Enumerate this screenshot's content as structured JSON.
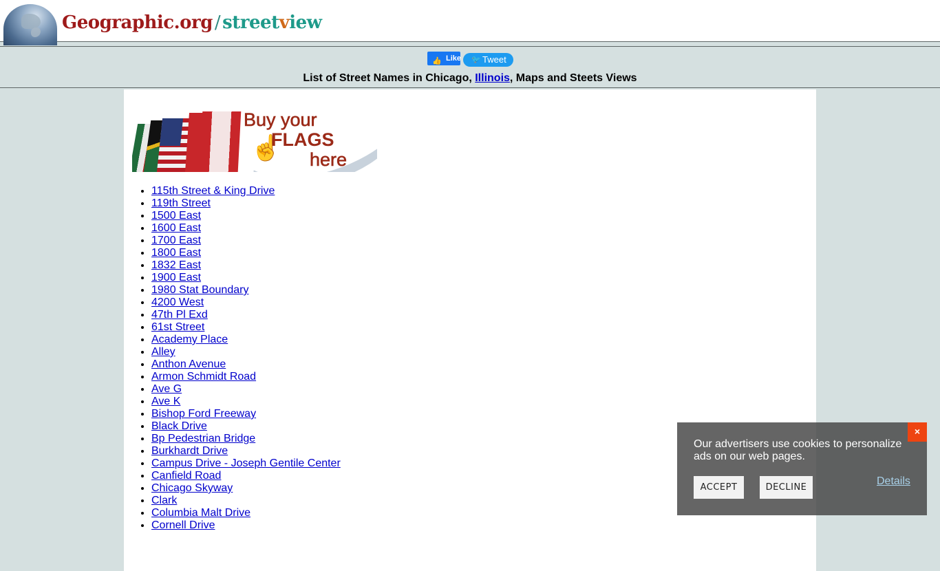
{
  "header": {
    "logo_part1": "Geographic.org",
    "logo_slash": "/",
    "logo_part2a": "street",
    "logo_part2b": "v",
    "logo_part2c": "iew",
    "globe_icon": "globe-icon"
  },
  "social": {
    "like_label": "Like",
    "like_icon": "thumbs-up-icon",
    "tweet_label": "Tweet",
    "tweet_icon": "twitter-bird-icon"
  },
  "heading": {
    "prefix": "List of Street Names in Chicago, ",
    "link": "Illinois",
    "suffix": ", Maps and Steets Views"
  },
  "banner": {
    "line1": "Buy your",
    "line2": "FLAGS",
    "line3": "here",
    "cursor_icon": "hand-pointer-icon"
  },
  "streets": [
    "115th Street & King Drive",
    "119th Street",
    "1500 East",
    "1600 East",
    "1700 East",
    "1800 East",
    "1832 East",
    "1900 East",
    "1980 Stat Boundary",
    "4200 West",
    "47th Pl Exd",
    "61st Street",
    "Academy Place",
    "Alley",
    "Anthon Avenue",
    "Armon Schmidt Road",
    "Ave G",
    "Ave K",
    "Bishop Ford Freeway",
    "Black Drive",
    "Bp Pedestrian Bridge",
    "Burkhardt Drive",
    "Campus Drive - Joseph Gentile Center",
    "Canfield Road",
    "Chicago Skyway",
    "Clark",
    "Columbia Malt Drive",
    "Cornell Drive"
  ],
  "cookie": {
    "message": "Our advertisers use cookies to personalize ads on our web pages.",
    "accept_label": "ACCEPT",
    "decline_label": "DECLINE",
    "details_label": "Details",
    "close_label": "×"
  },
  "colors": {
    "link": "#0000cc",
    "band_bg": "#d5e0e0",
    "logo_red": "#9e1a1a",
    "logo_teal": "#1e9a8a",
    "close_orange": "#ee4411"
  }
}
